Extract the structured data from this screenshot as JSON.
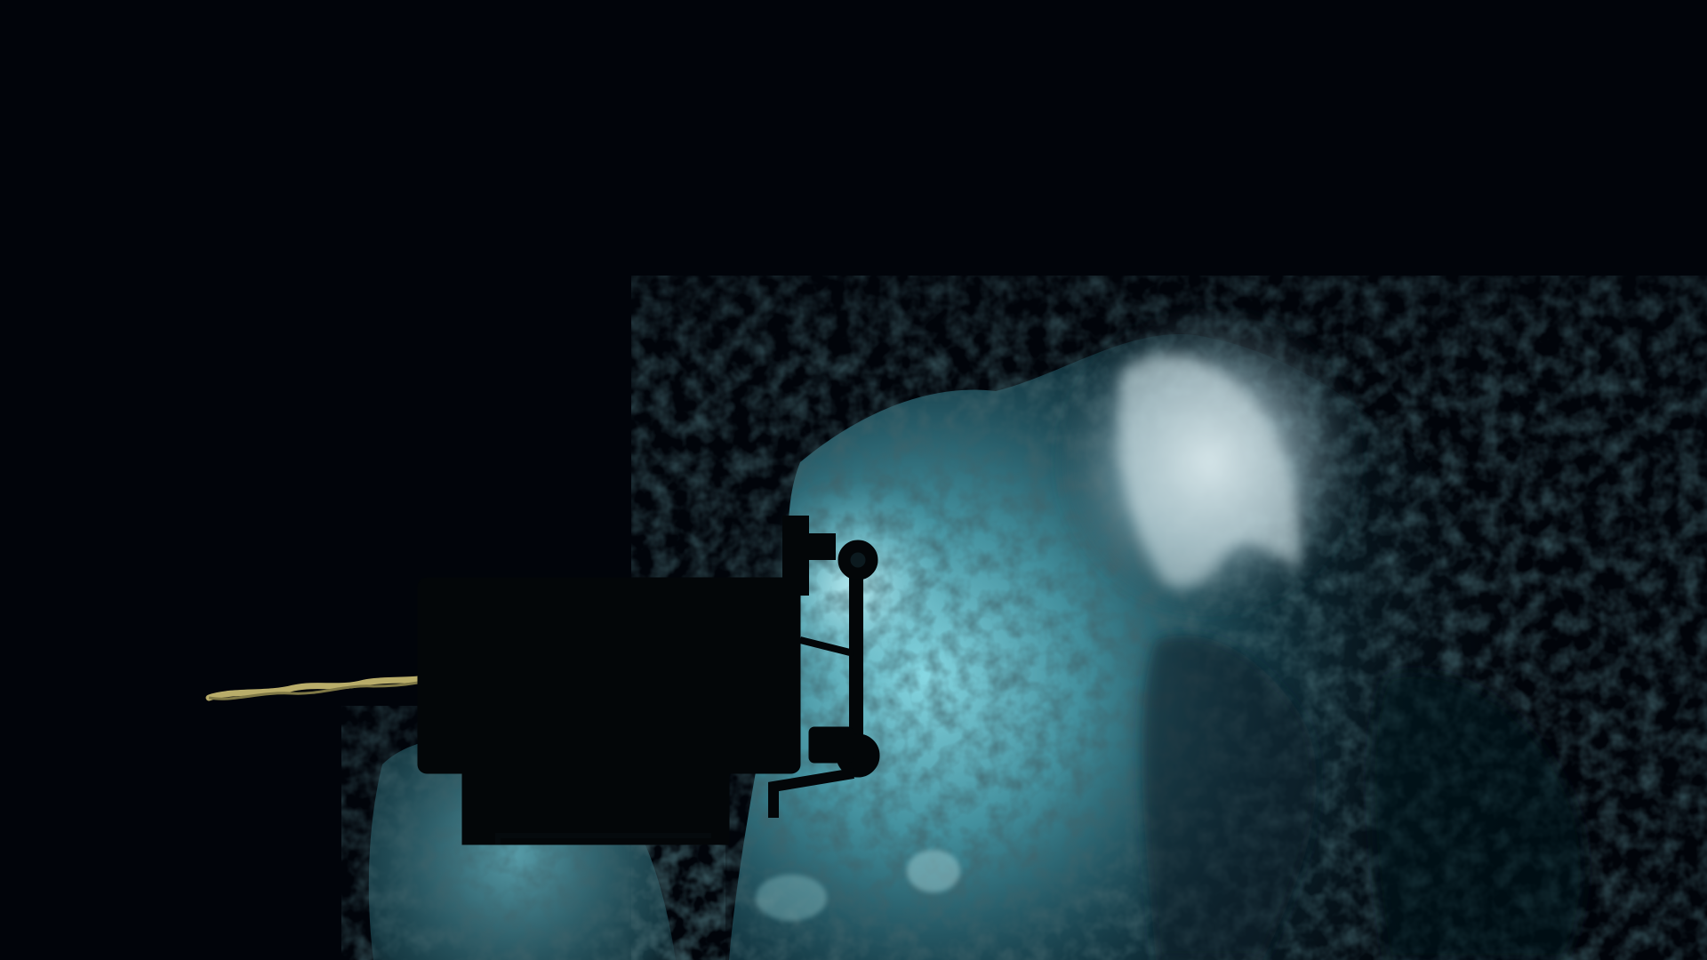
{
  "scene": {
    "kind": "deep-sea ROV camera frame",
    "water_color": "#01040a",
    "light_color": "#7fd8e6",
    "rock_color": "#3e7b86",
    "plume_color": "#c9dde4",
    "cable_color": "#b9ad6a"
  }
}
